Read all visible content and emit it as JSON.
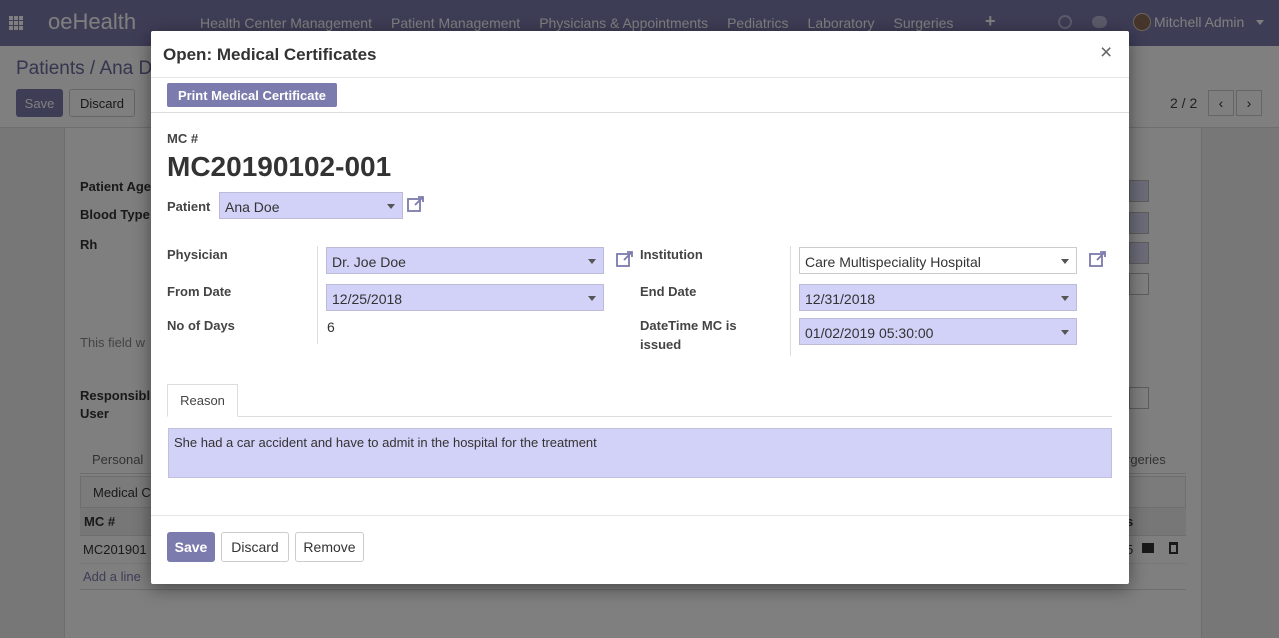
{
  "navbar": {
    "brand": "oeHealth",
    "menu": [
      "Health Center Management",
      "Patient Management",
      "Physicians & Appointments",
      "Pediatrics",
      "Laboratory",
      "Surgeries"
    ],
    "plus": "+",
    "user": "Mitchell Admin"
  },
  "background": {
    "breadcrumb": "Patients / Ana D",
    "save_label": "Save",
    "discard_label": "Discard",
    "pager": "2 / 2",
    "labels": {
      "patient_age": "Patient Age",
      "blood_type": "Blood Type",
      "rh": "Rh",
      "this_field": "This field w",
      "responsible": "Responsibl",
      "user": "User"
    },
    "tabs": {
      "personal": "Personal",
      "surgeries": "rgeries",
      "medical": "Medical C"
    },
    "table": {
      "header": "MC #",
      "header_right": "s",
      "row": "MC201901",
      "row_right": "5",
      "add_line": "Add a line"
    }
  },
  "modal": {
    "title": "Open: Medical Certificates",
    "close": "×",
    "print_button": "Print Medical Certificate",
    "mc_label": "MC #",
    "mc_number": "MC20190102-001",
    "patient": {
      "label": "Patient",
      "value": "Ana Doe"
    },
    "physician": {
      "label": "Physician",
      "value": "Dr. Joe Doe"
    },
    "institution": {
      "label": "Institution",
      "value": "Care Multispeciality Hospital"
    },
    "from_date": {
      "label": "From Date",
      "value": "12/25/2018"
    },
    "end_date": {
      "label": "End Date",
      "value": "12/31/2018"
    },
    "no_of_days": {
      "label": "No of Days",
      "value": "6"
    },
    "datetime_issued": {
      "label_line1": "DateTime MC is",
      "label_line2": "issued",
      "value": "01/02/2019 05:30:00"
    },
    "tab_reason": "Reason",
    "reason_text": "She had a car accident and have to admit in the hospital for the treatment",
    "footer": {
      "save": "Save",
      "discard": "Discard",
      "remove": "Remove"
    }
  },
  "colors": {
    "brand": "#7c7bad",
    "required_field": "#d2d1f7"
  }
}
